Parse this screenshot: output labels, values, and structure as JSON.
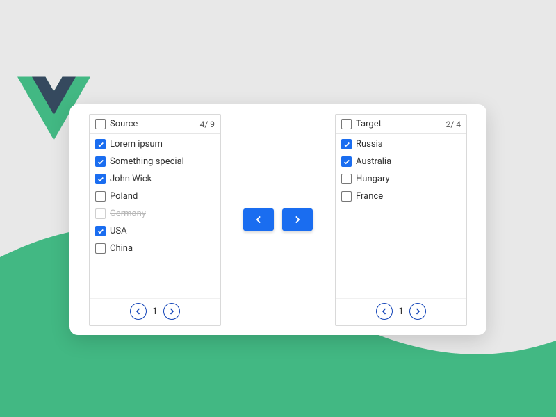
{
  "colors": {
    "accent": "#1a6df0",
    "green": "#42b883",
    "vue_dark": "#35495e"
  },
  "source": {
    "title": "Source",
    "count": "4/ 9",
    "page": "1",
    "items": [
      {
        "label": "Lorem ipsum",
        "checked": true,
        "disabled": false
      },
      {
        "label": "Something special",
        "checked": true,
        "disabled": false
      },
      {
        "label": "John Wick",
        "checked": true,
        "disabled": false
      },
      {
        "label": "Poland",
        "checked": false,
        "disabled": false
      },
      {
        "label": "Germany",
        "checked": false,
        "disabled": true
      },
      {
        "label": "USA",
        "checked": true,
        "disabled": false
      },
      {
        "label": "China",
        "checked": false,
        "disabled": false
      }
    ]
  },
  "target": {
    "title": "Target",
    "count": "2/ 4",
    "page": "1",
    "items": [
      {
        "label": "Russia",
        "checked": true,
        "disabled": false
      },
      {
        "label": "Australia",
        "checked": true,
        "disabled": false
      },
      {
        "label": "Hungary",
        "checked": false,
        "disabled": false
      },
      {
        "label": "France",
        "checked": false,
        "disabled": false
      }
    ]
  },
  "buttons": {
    "left": "<",
    "right": ">"
  }
}
